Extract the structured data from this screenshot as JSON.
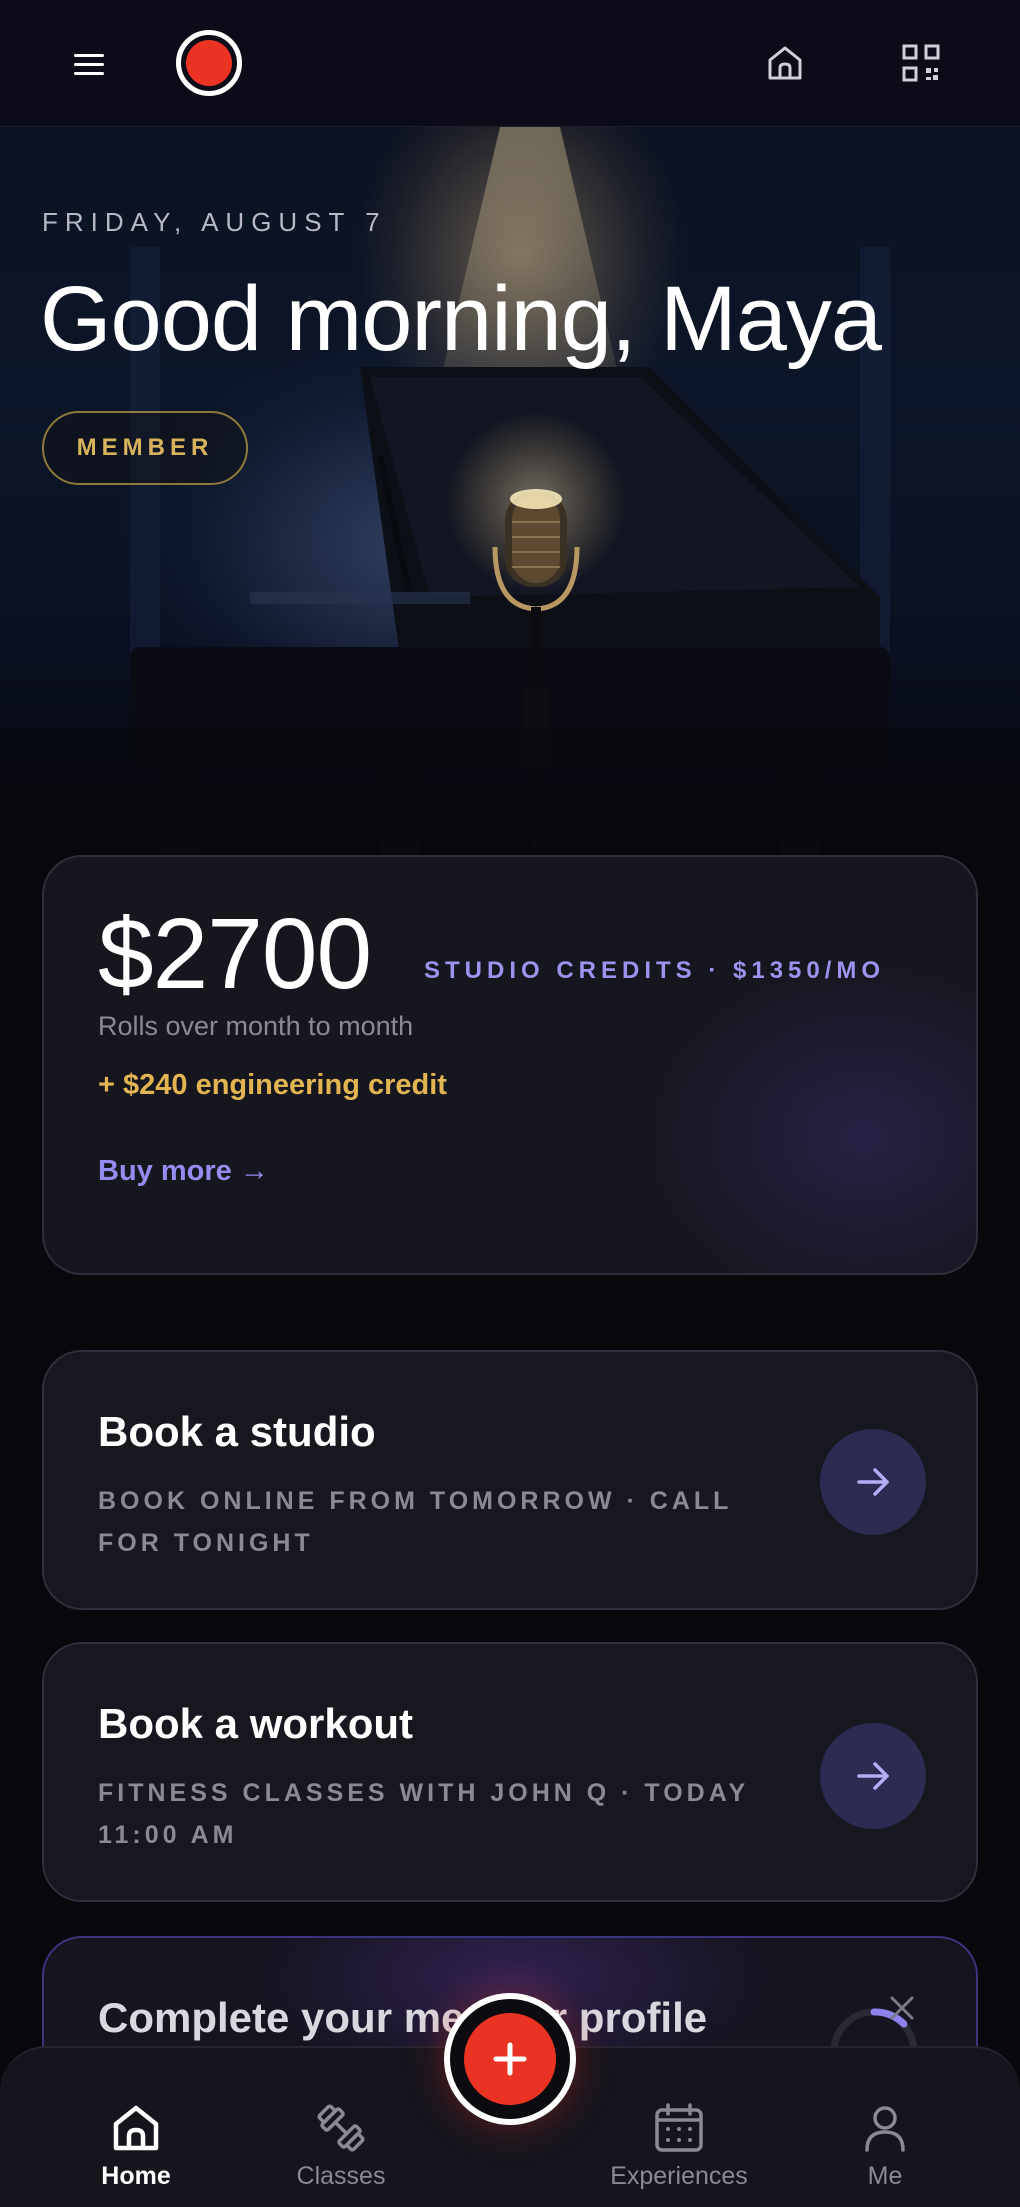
{
  "topbar": {
    "menu_icon": "hamburger-menu-icon",
    "record_icon": "record-icon",
    "home_icon": "home-icon",
    "qr_icon": "qr-code-icon",
    "record_color": "#ea3322"
  },
  "hero": {
    "date": "FRIDAY, AUGUST 7",
    "greeting": "Good morning, Maya",
    "badge": "MEMBER"
  },
  "credits": {
    "amount": "$2700",
    "label": "STUDIO CREDITS · $1350/MO",
    "subtitle": "Rolls over month to month",
    "bonus": "+ $240 engineering credit",
    "buy_more": "Buy more →"
  },
  "actions": [
    {
      "title": "Book a studio",
      "subtitle": "BOOK ONLINE FROM TOMORROW · CALL FOR TONIGHT",
      "icon": "arrow-right-icon"
    },
    {
      "title": "Book a workout",
      "subtitle": "FITNESS CLASSES WITH JOHN Q · TODAY 11:00 AM",
      "icon": "arrow-right-icon"
    }
  ],
  "profile_card": {
    "title": "Complete your member profile",
    "close_icon": "close-icon"
  },
  "fab": {
    "icon": "plus-icon"
  },
  "nav": {
    "home": "Home",
    "classes": "Classes",
    "experiences": "Experiences",
    "me": "Me"
  },
  "colors": {
    "accent_purple": "#958cf0",
    "accent_gold": "#e2b552",
    "record_red": "#ea3322"
  }
}
